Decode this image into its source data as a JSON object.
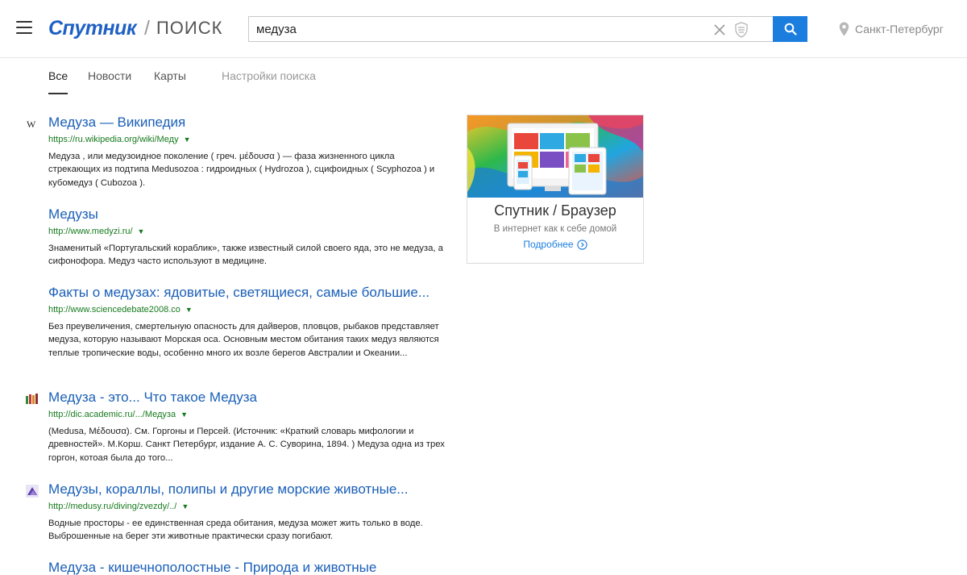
{
  "header": {
    "logo_brand": "Спутник",
    "logo_separator": "/",
    "logo_product": "ПОИСК",
    "search_value": "медуза",
    "location": "Санкт-Петербург"
  },
  "tabs": [
    {
      "label": "Все",
      "active": true
    },
    {
      "label": "Новости",
      "active": false
    },
    {
      "label": "Карты",
      "active": false
    },
    {
      "label": "Настройки поиска",
      "active": false
    }
  ],
  "results": [
    {
      "icon": "wikipedia-icon",
      "title": "Медуза — Википедия",
      "url": "https://ru.wikipedia.org/wiki/Меду",
      "snippet": "Медуза , или медузоидное поколение ( греч. μέδουσα ) — фаза жизненного цикла стрекающих из подтипа Medusozoa : гидроидных ( Hydrozoa ), сцифоидных ( Scyphozoa ) и кубомедуз ( Cubozoa )."
    },
    {
      "icon": "",
      "title": "Медузы",
      "url": "http://www.medyzi.ru/",
      "snippet": "Знаменитый «Португальский кораблик», также известный силой своего яда, это не медуза, а сифонофора. Медуз часто используют в медицине."
    },
    {
      "icon": "",
      "title": "Факты о медузах: ядовитые, светящиеся, самые большие...",
      "url": "http://www.sciencedebate2008.co",
      "snippet": "Без преувеличения, смертельную опасность для дайверов, пловцов, рыбаков представляет медуза, которую называют Морская оса. Основным местом обитания таких медуз являются теплые тропические воды, особенно много их возле берегов Австралии и Океании..."
    },
    {
      "icon": "academic-icon",
      "title": "Медуза - это... Что такое Медуза",
      "url": "http://dic.academic.ru/.../Медуза",
      "snippet": "(Medusa, Μέδουσα). См. Горгоны и Персей. (Источник: «Краткий словарь мифологии и древностей». М.Корш. Санкт Петербург, издание А. С. Суворина, 1894. ) Медуза одна из трех горгон, котоая была до того..."
    },
    {
      "icon": "medusy-icon",
      "title": "Медузы, кораллы, полипы и другие морские животные...",
      "url": "http://medusy.ru/diving/zvezdy/../",
      "snippet": "Водные просторы - ее единственная среда обитания, медуза может жить только в воде. Выброшенные на берег эти животные практически сразу погибают."
    },
    {
      "icon": "",
      "title": "Медуза - кишечнополостные - Природа и животные",
      "url": "",
      "snippet": ""
    }
  ],
  "ad": {
    "title": "Спутник / Браузер",
    "subtitle": "В интернет как к себе домой",
    "more_label": "Подробнее"
  },
  "colors": {
    "link": "#1a5fb8",
    "url": "#167a1d",
    "accent": "#1b7ede"
  }
}
